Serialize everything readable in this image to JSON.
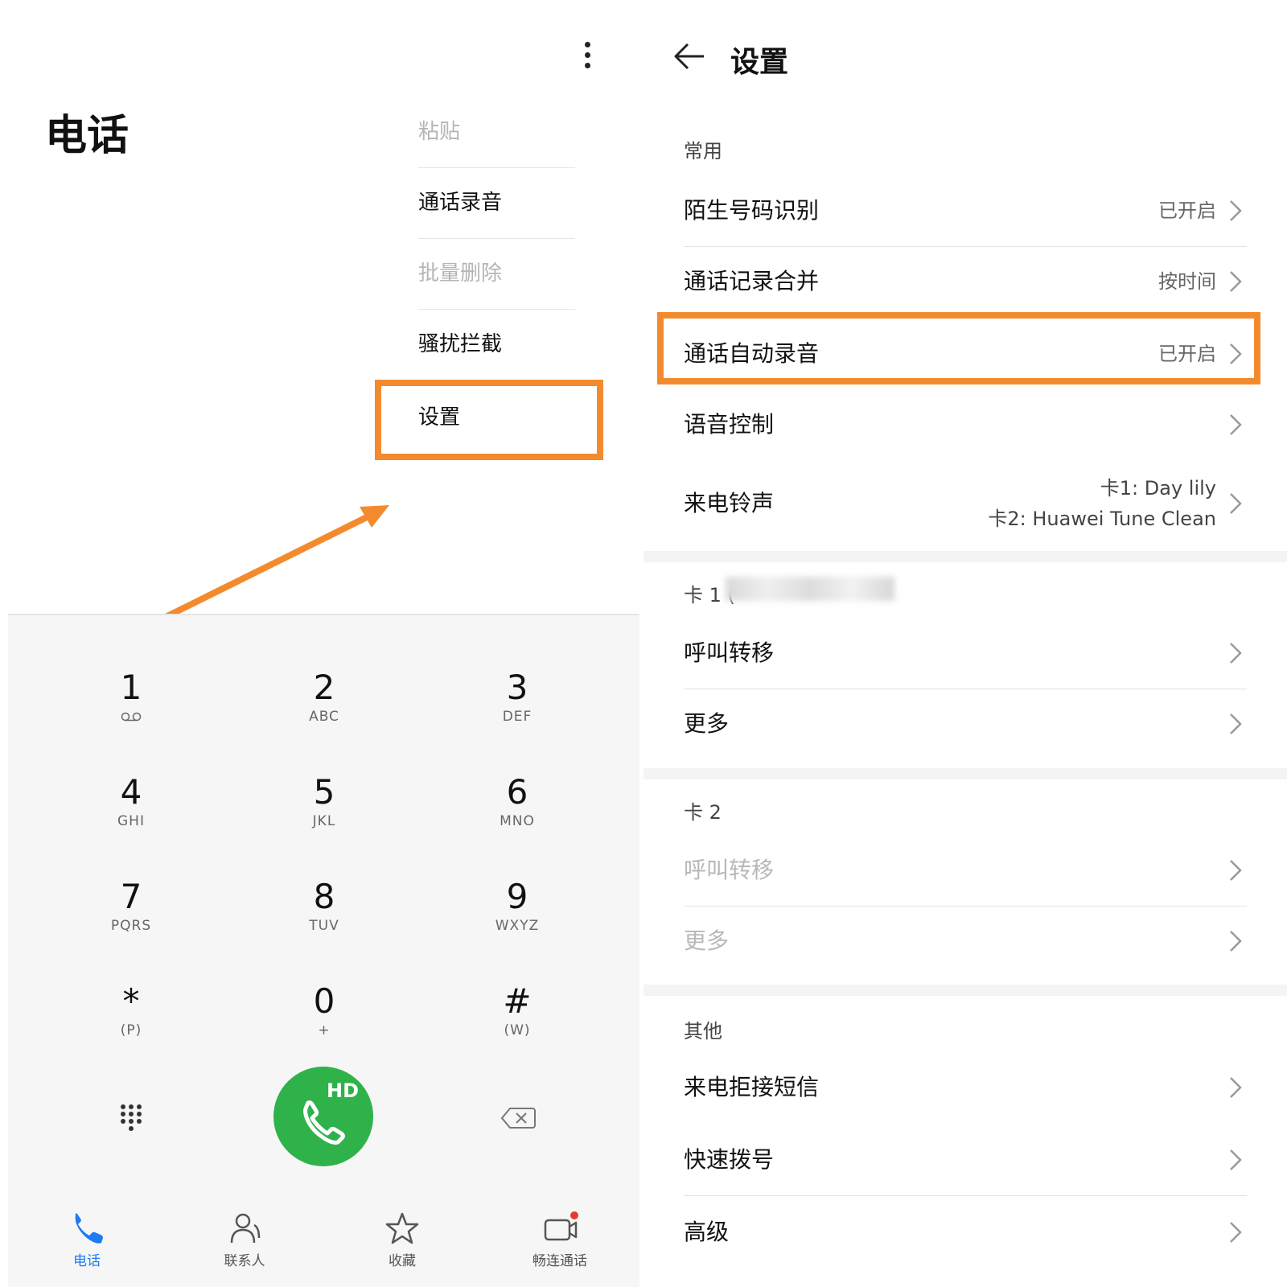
{
  "phone": {
    "title": "电话",
    "menu": {
      "paste": "粘贴",
      "call_recording": "通话录音",
      "batch_delete": "批量删除",
      "harassment_block": "骚扰拦截",
      "settings": "设置"
    },
    "keys": [
      {
        "num": "1",
        "letters": ""
      },
      {
        "num": "2",
        "letters": "ABC"
      },
      {
        "num": "3",
        "letters": "DEF"
      },
      {
        "num": "4",
        "letters": "GHI"
      },
      {
        "num": "5",
        "letters": "JKL"
      },
      {
        "num": "6",
        "letters": "MNO"
      },
      {
        "num": "7",
        "letters": "PQRS"
      },
      {
        "num": "8",
        "letters": "TUV"
      },
      {
        "num": "9",
        "letters": "WXYZ"
      },
      {
        "num": "*",
        "letters": "(P)"
      },
      {
        "num": "0",
        "letters": "+"
      },
      {
        "num": "#",
        "letters": "(W)"
      }
    ],
    "call_button_label": "HD",
    "tabs": {
      "phone": "电话",
      "contacts": "联系人",
      "favorites": "收藏",
      "meetime": "畅连通话"
    }
  },
  "settings": {
    "title": "设置",
    "common": {
      "header": "常用",
      "unknown_number": {
        "label": "陌生号码识别",
        "value": "已开启"
      },
      "merge_logs": {
        "label": "通话记录合并",
        "value": "按时间"
      },
      "auto_record": {
        "label": "通话自动录音",
        "value": "已开启"
      },
      "voice_control": {
        "label": "语音控制"
      },
      "ringtone": {
        "label": "来电铃声",
        "value_card1": "卡1: Day lily",
        "value_card2": "卡2: Huawei Tune Clean"
      }
    },
    "card1": {
      "header": "卡 1 (",
      "forwarding": "呼叫转移",
      "more": "更多"
    },
    "card2": {
      "header": "卡 2",
      "forwarding": "呼叫转移",
      "more": "更多"
    },
    "other": {
      "header": "其他",
      "reject_sms": "来电拒接短信",
      "speed_dial": "快速拨号",
      "advanced": "高级"
    }
  },
  "colors": {
    "highlight": "#F38B2E",
    "call_green": "#2fb24a",
    "active_tab": "#1e7bf0"
  }
}
